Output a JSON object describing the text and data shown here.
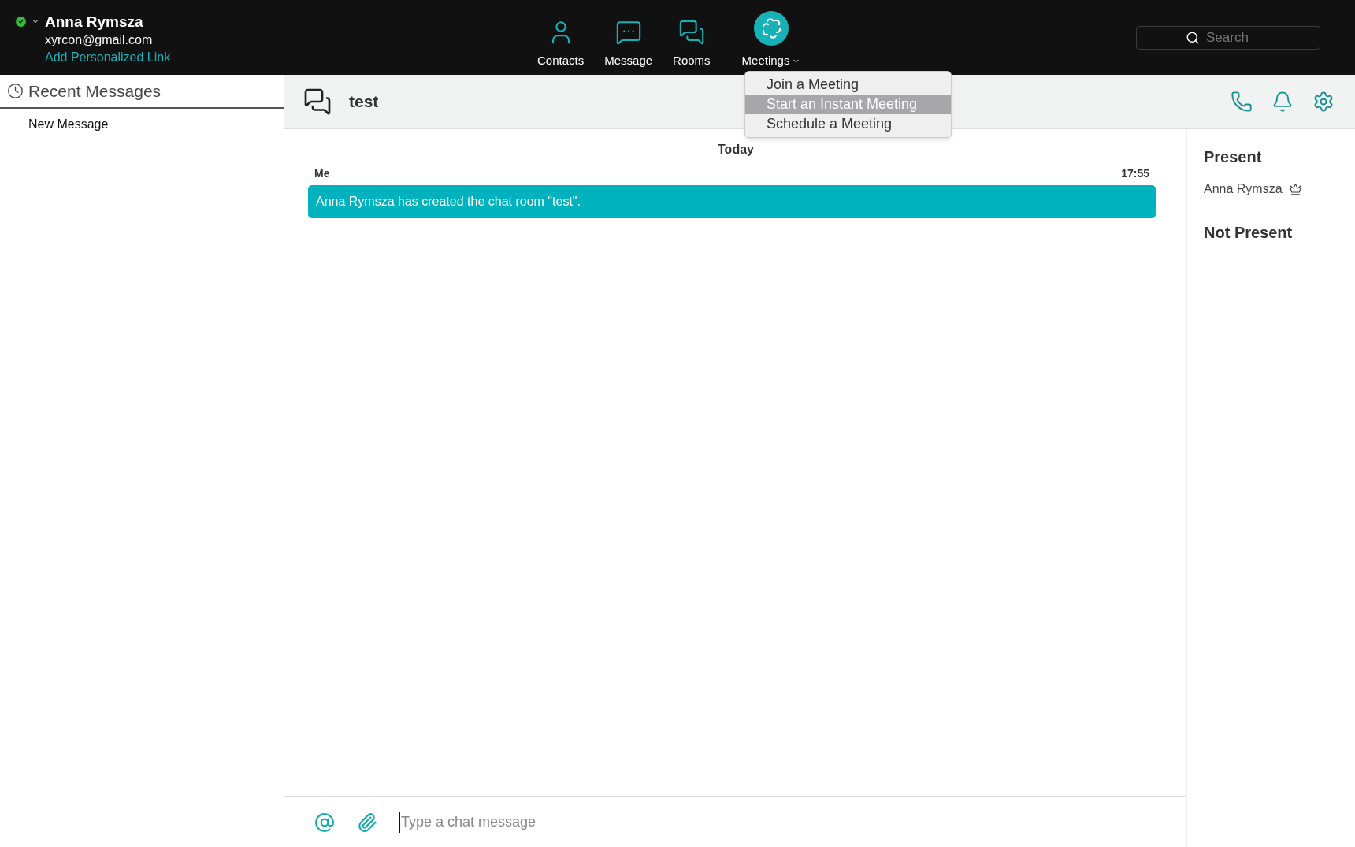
{
  "user": {
    "name": "Anna Rymsza",
    "email": "xyrcon@gmail.com",
    "link": "Add Personalized Link",
    "online": true
  },
  "nav": [
    {
      "kind": "contacts",
      "label": "Contacts"
    },
    {
      "kind": "message",
      "label": "Message"
    },
    {
      "kind": "rooms",
      "label": "Rooms"
    },
    {
      "kind": "meetings",
      "label": "Meetings"
    }
  ],
  "search": {
    "placeholder": "Search"
  },
  "meetings_menu": [
    {
      "label": "Join a Meeting",
      "selected": false
    },
    {
      "label": "Start an Instant Meeting",
      "selected": true
    },
    {
      "label": "Schedule a Meeting",
      "selected": false
    }
  ],
  "sidebar": {
    "title": "Recent Messages",
    "items": [
      "New Message"
    ]
  },
  "chat": {
    "title": "test",
    "day": "Today",
    "messages": [
      {
        "sender": "Me",
        "time": "17:55",
        "text": "Anna Rymsza has created the chat room \"test\"."
      }
    ],
    "input": {
      "placeholder": "Type a chat message"
    }
  },
  "participants": {
    "present_title": "Present",
    "present": [
      {
        "name": "Anna Rymsza",
        "owner": true
      }
    ],
    "not_present_title": "Not Present"
  }
}
